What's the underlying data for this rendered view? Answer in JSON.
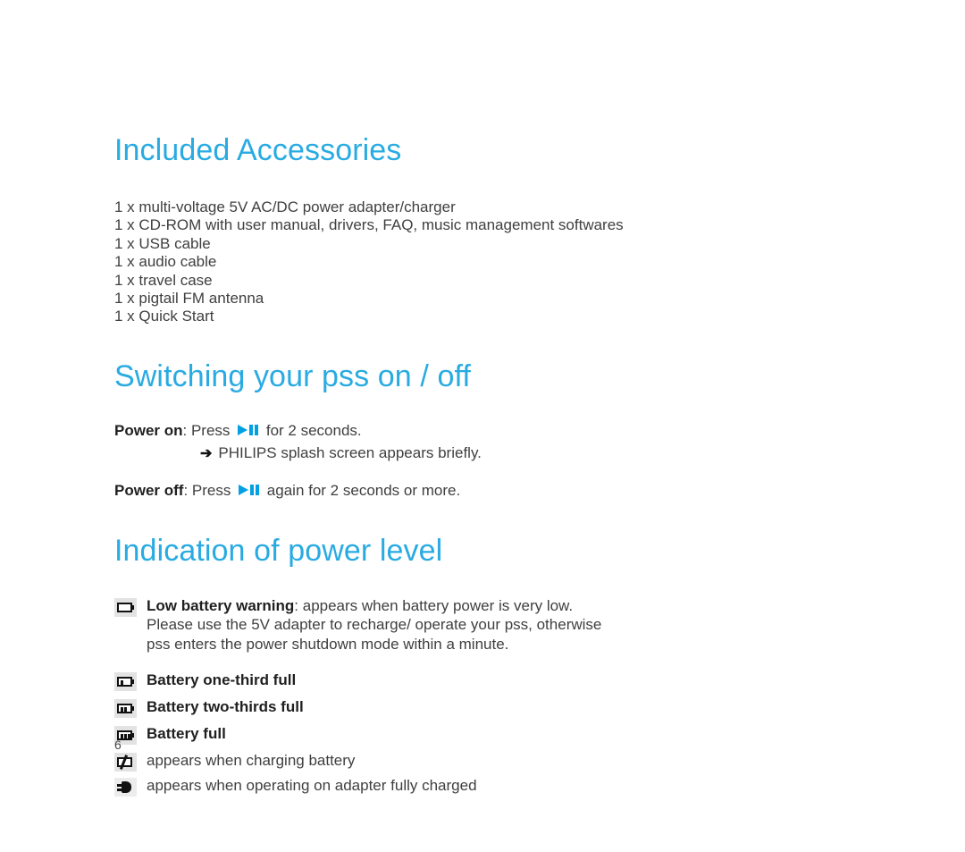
{
  "page": {
    "number": "6",
    "accent_color": "#29ABE2",
    "icon_blue": "#00A0E3"
  },
  "sections": {
    "accessories": {
      "heading": "Included Accessories",
      "items": [
        "1 x multi-voltage 5V AC/DC power adapter/charger",
        "1 x CD-ROM with user manual, drivers, FAQ, music management softwares",
        "1 x USB cable",
        "1 x audio cable",
        "1 x travel case",
        "1 x pigtail FM antenna",
        "1 x Quick Start"
      ]
    },
    "switching": {
      "heading": "Switching your pss on / off",
      "power_on": {
        "label": "Power on",
        "before_icon": ": Press ",
        "icon": "play-pause-icon",
        "after_icon": " for 2 seconds.",
        "note_arrow": "➔",
        "note": "PHILIPS splash screen appears briefly."
      },
      "power_off": {
        "label": "Power off",
        "before_icon": ": Press ",
        "icon": "play-pause-icon",
        "after_icon": " again for 2 seconds or more."
      }
    },
    "indication": {
      "heading": "Indication of power level",
      "rows": [
        {
          "icon": "battery-empty-icon",
          "bold": "Low battery warning",
          "rest": ": appears when battery power is very low.",
          "extra_lines": [
            "Please use the 5V adapter to recharge/ operate your pss, otherwise",
            "pss enters the power shutdown mode within a minute."
          ]
        },
        {
          "icon": "battery-one-third-icon",
          "bold": "Battery one-third full",
          "rest": "",
          "extra_lines": []
        },
        {
          "icon": "battery-two-thirds-icon",
          "bold": "Battery two-thirds full",
          "rest": "",
          "extra_lines": []
        },
        {
          "icon": "battery-full-icon",
          "bold": "Battery full",
          "rest": "",
          "extra_lines": []
        },
        {
          "icon": "battery-charging-icon",
          "bold": "",
          "rest": "appears when charging battery",
          "extra_lines": []
        },
        {
          "icon": "power-plug-icon",
          "bold": "",
          "rest": "appears when operating on adapter fully charged",
          "extra_lines": []
        }
      ]
    }
  }
}
